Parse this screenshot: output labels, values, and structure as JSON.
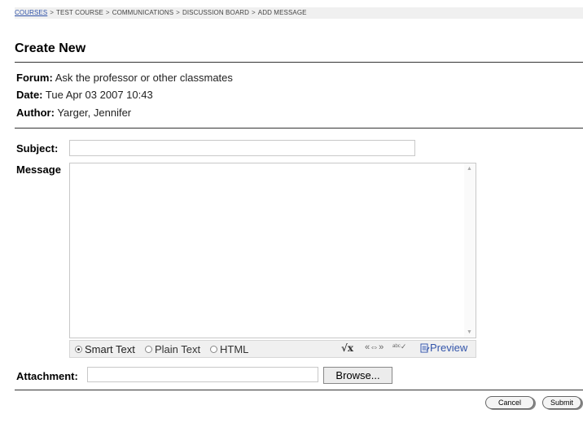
{
  "breadcrumb": {
    "items": [
      "COURSES",
      "TEST COURSE",
      "COMMUNICATIONS",
      "DISCUSSION BOARD",
      "ADD MESSAGE"
    ],
    "separator": ">"
  },
  "page_title": "Create New",
  "meta": {
    "forum_label": "Forum:",
    "forum_value": "Ask the professor or other classmates",
    "date_label": "Date:",
    "date_value": "Tue Apr 03 2007 10:43",
    "author_label": "Author:",
    "author_value": "Yarger, Jennifer"
  },
  "form": {
    "subject_label": "Subject:",
    "subject_value": "",
    "message_label": "Message",
    "message_value": "",
    "format_options": [
      "Smart Text",
      "Plain Text",
      "HTML"
    ],
    "selected_format": "Smart Text",
    "toolbar_icons": [
      "math-formula-icon",
      "insert-link-icon",
      "spellcheck-icon"
    ],
    "preview_label": "Preview",
    "attachment_label": "Attachment:",
    "attachment_value": "",
    "browse_label": "Browse..."
  },
  "actions": {
    "cancel_label": "Cancel",
    "submit_label": "Submit"
  }
}
